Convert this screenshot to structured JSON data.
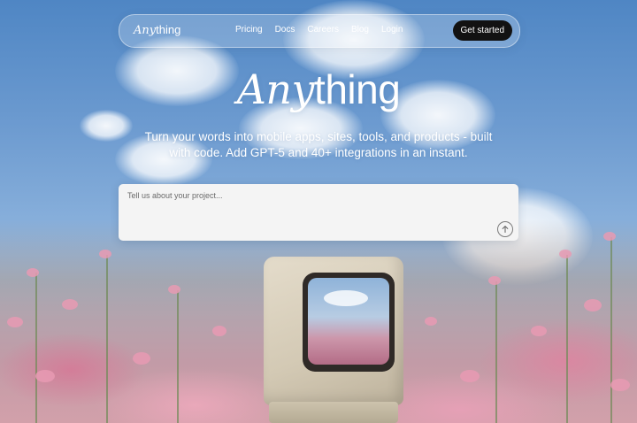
{
  "nav": {
    "logo_script": "Any",
    "logo_plain": "thing",
    "links": [
      "Pricing",
      "Docs",
      "Careers",
      "Blog",
      "Login"
    ],
    "cta_label": "Get started"
  },
  "hero": {
    "brand_script": "Any",
    "brand_plain": "thing",
    "subtitle": "Turn your words into mobile apps, sites, tools, and products - built with code. Add GPT-5 and 40+ integrations in an instant."
  },
  "prompt": {
    "placeholder": "Tell us about your project...",
    "value": "",
    "send_icon": "arrow-up-icon"
  },
  "colors": {
    "cta_bg": "#121212",
    "text_on_sky": "#ffffff",
    "prompt_bg": "#f4f4f4"
  }
}
